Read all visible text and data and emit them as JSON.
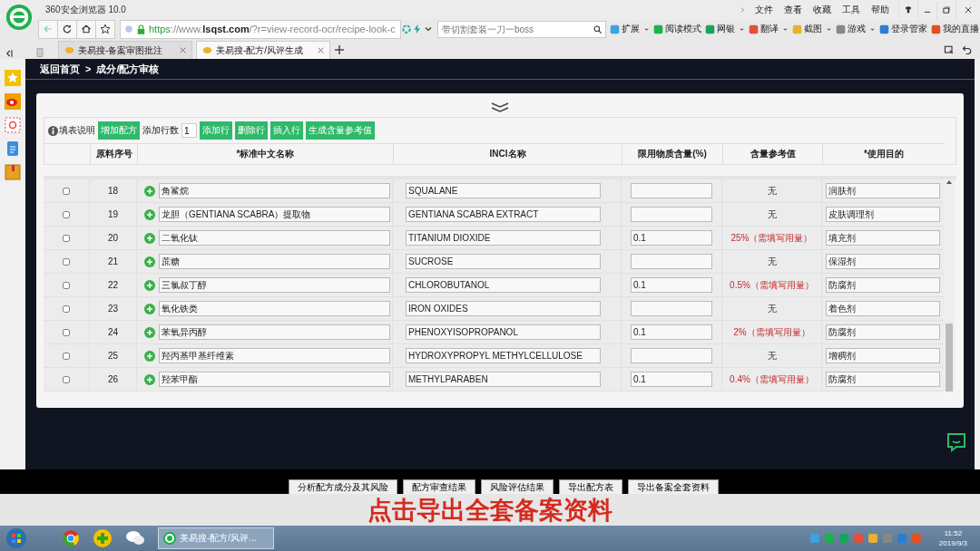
{
  "browser": {
    "title": "360安全浏览器 10.0",
    "menu": [
      "文件",
      "查看",
      "收藏",
      "工具",
      "帮助"
    ],
    "url": {
      "scheme": "https",
      "host_prefix": "://www.",
      "domain": "lsqst.com",
      "path": "/?r=view-record-ocr/recipe-look-c"
    },
    "search": {
      "placeholder": "带切割套装一刀一boss"
    },
    "tools": [
      {
        "label": "扩展",
        "caret": true
      },
      {
        "label": "阅读模式",
        "caret": false
      },
      {
        "label": "网银",
        "caret": true
      },
      {
        "label": "翻译",
        "caret": true
      },
      {
        "label": "截图",
        "caret": true
      },
      {
        "label": "游戏",
        "caret": true
      },
      {
        "label": "登录管家",
        "caret": false
      },
      {
        "label": "我的直播",
        "caret": false
      }
    ],
    "tabs": [
      {
        "title": "美易搜-备案审图批注",
        "selected": false
      },
      {
        "title": "美易搜-配方/风评生成",
        "selected": true
      }
    ]
  },
  "page": {
    "breadcrumb": {
      "home": "返回首页",
      "separator": ">",
      "current": "成分/配方审核"
    },
    "toolbar": {
      "help": "填表说明",
      "add_formula": "增加配方",
      "rows_label": "添加行数",
      "rows_value": "1",
      "actions": [
        "添加行",
        "删除行",
        "插入行",
        "生成含量参考值"
      ]
    },
    "table": {
      "columns": [
        "原料序号",
        "*标准中文名称",
        "INCI名称",
        "限用物质含量(%)",
        "含量参考值",
        "*使用目的"
      ],
      "rows": [
        {
          "checked": false,
          "no": "18",
          "cn": "角鲨烷",
          "inci": "SQUALANE",
          "limit": "",
          "ref": "无",
          "kind": "none",
          "purpose": "润肤剂"
        },
        {
          "checked": false,
          "no": "19",
          "cn": "龙胆（GENTIANA SCABRA）提取物",
          "inci": "GENTIANA SCABRA EXTRACT",
          "limit": "",
          "ref": "无",
          "kind": "none",
          "purpose": "皮肤调理剂"
        },
        {
          "checked": false,
          "no": "20",
          "cn": "二氧化钛",
          "inci": "TITANIUM DIOXIDE",
          "limit": "0.1",
          "ref": "25%（需填写用量）",
          "kind": "required",
          "purpose": "填充剂"
        },
        {
          "checked": false,
          "no": "21",
          "cn": "蔗糖",
          "inci": "SUCROSE",
          "limit": "",
          "ref": "无",
          "kind": "none",
          "purpose": "保湿剂"
        },
        {
          "checked": false,
          "no": "22",
          "cn": "三氯叔丁醇",
          "inci": "CHLOROBUTANOL",
          "limit": "0.1",
          "ref": "0.5%（需填写用量）",
          "kind": "required",
          "purpose": "防腐剂"
        },
        {
          "checked": false,
          "no": "23",
          "cn": "氧化铁类",
          "inci": "IRON OXIDES",
          "limit": "",
          "ref": "无",
          "kind": "none",
          "purpose": "着色剂"
        },
        {
          "checked": false,
          "no": "24",
          "cn": "苯氧异丙醇",
          "inci": "PHENOXYISOPROPANOL",
          "limit": "0.1",
          "ref": "2%（需填写用量）",
          "kind": "required",
          "purpose": "防腐剂"
        },
        {
          "checked": false,
          "no": "25",
          "cn": "羟丙基甲基纤维素",
          "inci": "HYDROXYPROPYL METHYLCELLULOSE",
          "limit": "",
          "ref": "无",
          "kind": "none",
          "purpose": "增稠剂"
        },
        {
          "checked": false,
          "no": "26",
          "cn": "羟苯甲酯",
          "inci": "METHYLPARABEN",
          "limit": "0.1",
          "ref": "0.4%（需填写用量）",
          "kind": "required",
          "purpose": "防腐剂"
        }
      ]
    },
    "bottom_buttons": [
      "分析配方成分及其风险",
      "配方审查结果",
      "风险评估结果",
      "导出配方表",
      "导出备案全套资料"
    ]
  },
  "caption": "点击导出全套备案资料",
  "taskbar": {
    "window": "美易搜-配方/风评...",
    "time": "11:52",
    "date": "2019/9/3"
  }
}
